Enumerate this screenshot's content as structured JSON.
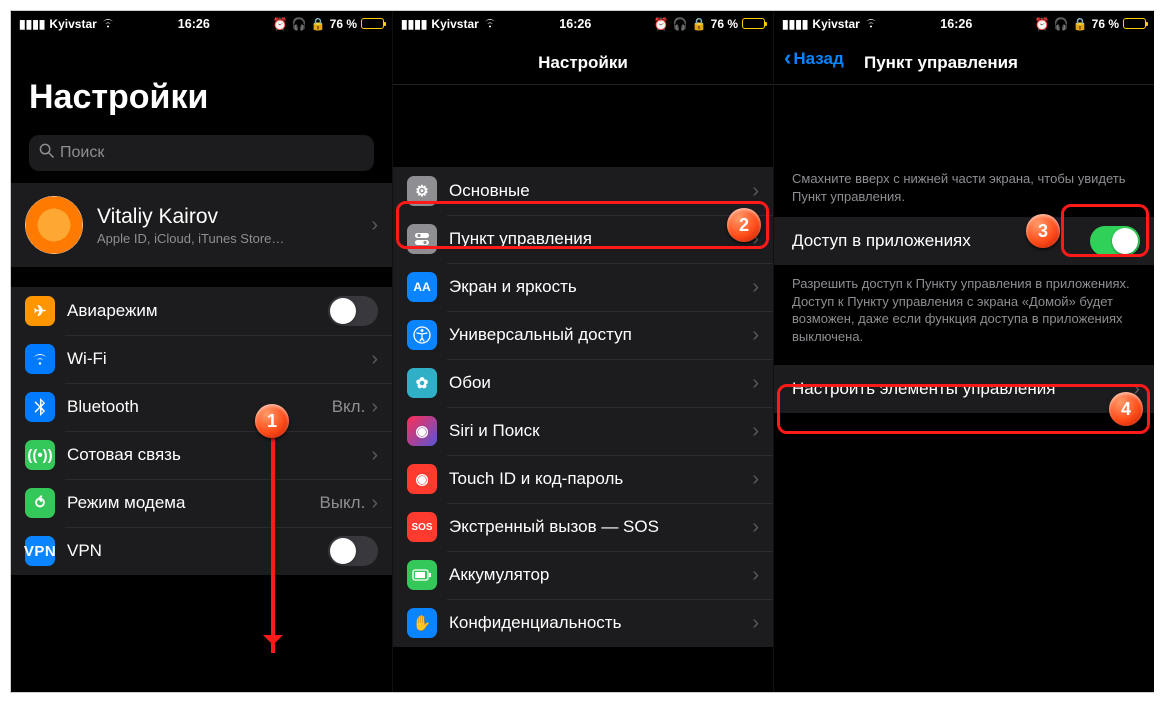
{
  "status": {
    "carrier": "Kyivstar",
    "time": "16:26",
    "battery_pct": "76 %"
  },
  "screen1": {
    "title": "Настройки",
    "search_placeholder": "Поиск",
    "profile": {
      "name": "Vitaliy Kairov",
      "sub": "Apple ID, iCloud, iTunes Store…"
    },
    "items": [
      {
        "label": "Авиарежим",
        "detail": "",
        "kind": "toggle",
        "on": false
      },
      {
        "label": "Wi-Fi",
        "detail": "",
        "kind": "link"
      },
      {
        "label": "Bluetooth",
        "detail": "Вкл.",
        "kind": "link"
      },
      {
        "label": "Сотовая связь",
        "detail": "",
        "kind": "link"
      },
      {
        "label": "Режим модема",
        "detail": "Выкл.",
        "kind": "link"
      },
      {
        "label": "VPN",
        "detail": "",
        "kind": "toggle",
        "on": false
      }
    ]
  },
  "screen2": {
    "title": "Настройки",
    "items": [
      {
        "label": "Основные"
      },
      {
        "label": "Пункт управления"
      },
      {
        "label": "Экран и яркость"
      },
      {
        "label": "Универсальный доступ"
      },
      {
        "label": "Обои"
      },
      {
        "label": "Siri и Поиск"
      },
      {
        "label": "Touch ID и код-пароль"
      },
      {
        "label": "Экстренный вызов — SOS"
      },
      {
        "label": "Аккумулятор"
      },
      {
        "label": "Конфиденциальность"
      }
    ]
  },
  "screen3": {
    "back": "Назад",
    "title": "Пункт управления",
    "header_note": "Смахните вверх с нижней части экрана, чтобы увидеть Пункт управления.",
    "access_label": "Доступ в приложениях",
    "access_on": true,
    "footer_note": "Разрешить доступ к Пункту управления в приложениях. Доступ к Пункту управления с экрана «Домой» будет возможен, даже если функция доступа в приложениях выключена.",
    "customize_label": "Настроить элементы управления"
  },
  "badges": {
    "b1": "1",
    "b2": "2",
    "b3": "3",
    "b4": "4"
  }
}
